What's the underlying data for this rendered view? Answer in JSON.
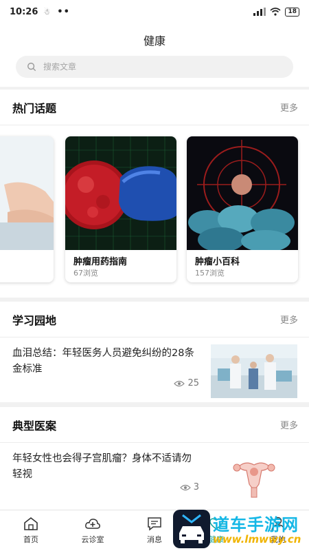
{
  "status_bar": {
    "time": "10:26",
    "battery": "18"
  },
  "header": {
    "title": "健康",
    "search_placeholder": "搜索文章"
  },
  "hot_topics": {
    "title": "热门话题",
    "more": "更多",
    "cards": [
      {
        "name": "肿瘤用药指南",
        "views": "67浏览"
      },
      {
        "name": "肿瘤小百科",
        "views": "157浏览"
      }
    ]
  },
  "study": {
    "title": "学习园地",
    "more": "更多",
    "article": {
      "title": "血泪总结：年轻医务人员避免纠纷的28条金标准",
      "views": "25"
    }
  },
  "cases": {
    "title": "典型医案",
    "more": "更多",
    "article": {
      "title": "年轻女性也会得子宫肌瘤？身体不适请勿轻视",
      "views": "3"
    }
  },
  "tabbar": {
    "items": [
      {
        "label": "首页"
      },
      {
        "label": "云诊室"
      },
      {
        "label": "消息"
      },
      {
        "label": "健康"
      },
      {
        "label": "我的"
      }
    ]
  },
  "watermark": {
    "text": "道车手游网",
    "url": "www.lmwwy.cn"
  }
}
